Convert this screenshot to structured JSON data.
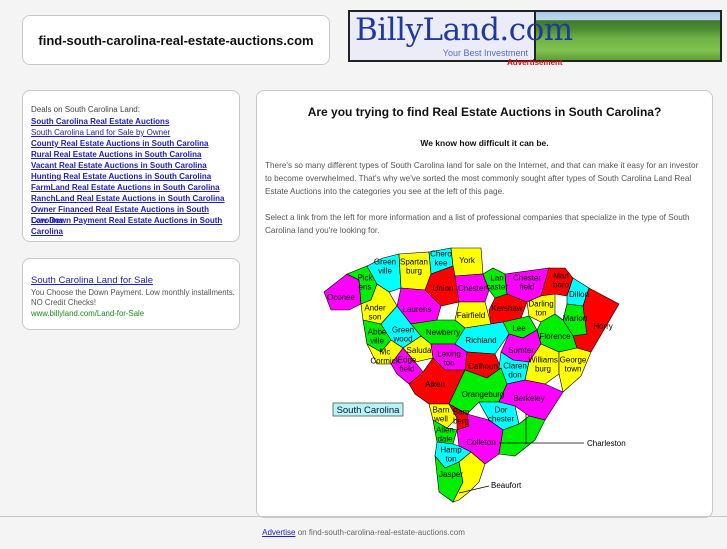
{
  "header": {
    "site_title": "find-south-carolina-real-estate-auctions.com",
    "banner": {
      "brand": "BillyLand.com",
      "tagline": "Your Best Investment",
      "ad_label": "Advertisement"
    }
  },
  "sidebar": {
    "deals_heading": "Deals on South Carolina Land:",
    "links": [
      {
        "label": "South Carolina Real Estate Auctions",
        "bold": true
      },
      {
        "label": "South Carolina Land for Sale by Owner",
        "bold": false
      },
      {
        "label": "County Real Estate Auctions in South Carolina",
        "bold": true
      },
      {
        "label": "Rural Real Estate Auctions in South Carolina",
        "bold": true
      },
      {
        "label": "Vacant Real Estate Auctions in South Carolina",
        "bold": true
      },
      {
        "label": "Hunting Real Estate Auctions in South Carolina",
        "bold": true
      },
      {
        "label": "FarmLand Real Estate Auctions in South Carolina",
        "bold": true
      },
      {
        "label": "RanchLand Real Estate Auctions in South Carolina",
        "bold": true
      },
      {
        "label": "Owner Financed Real Estate Auctions in South Carolina",
        "bold": true
      },
      {
        "label": "Low Down Payment Real Estate Auctions in South Carolina",
        "bold": true
      }
    ],
    "ad": {
      "title": "South Carolina Land for Sale",
      "description": "You Choose the Down Payment. Low monthly installments. NO Credit Checks!",
      "url": "www.billyland.com/Land-for-Sale"
    }
  },
  "main": {
    "headline": "Are you trying to find Real Estate Auctions in South Carolina?",
    "subheadline": "We know how difficult it can be.",
    "paragraph1": "There's so many different types of South Carolina land for sale on the Internet, and that can make it easy for an investor to become overwhelmed. That's why we've sorted the most commonly sought after types of South Carolina Land Real Estate Auctions into the categories you see at the left of this page.",
    "paragraph2": "Select a link from the left for more information and a list of professional companies that specialize in the type of South Carolina land you're looking for.",
    "map": {
      "state_label": "South Carolina",
      "colors": {
        "yellow": "#ffff00",
        "cyan": "#00ffff",
        "magenta": "#ff00ff",
        "green": "#00ee00",
        "red": "#ff0000"
      },
      "counties": [
        {
          "name": "Oconee",
          "lines": [
            "Oconee"
          ],
          "color": "magenta"
        },
        {
          "name": "Pickens",
          "lines": [
            "Pick",
            "ens"
          ],
          "color": "green"
        },
        {
          "name": "Greenville",
          "lines": [
            "Green",
            "ville"
          ],
          "color": "cyan"
        },
        {
          "name": "Spartanburg",
          "lines": [
            "Spartan",
            "burg"
          ],
          "color": "yellow"
        },
        {
          "name": "Cherokee",
          "lines": [
            "Chero",
            "kee"
          ],
          "color": "cyan"
        },
        {
          "name": "York",
          "lines": [
            "York"
          ],
          "color": "yellow"
        },
        {
          "name": "Union",
          "lines": [
            "Union"
          ],
          "color": "red"
        },
        {
          "name": "Chester",
          "lines": [
            "Chester"
          ],
          "color": "magenta"
        },
        {
          "name": "Lancaster",
          "lines": [
            "Lan",
            "caster"
          ],
          "color": "green"
        },
        {
          "name": "Chesterfield",
          "lines": [
            "Chester",
            "field"
          ],
          "color": "magenta"
        },
        {
          "name": "Marlboro",
          "lines": [
            "Marl",
            "boro"
          ],
          "color": "red"
        },
        {
          "name": "Dillon",
          "lines": [
            "Dillon"
          ],
          "color": "cyan"
        },
        {
          "name": "Anderson",
          "lines": [
            "Ander",
            "son"
          ],
          "color": "yellow"
        },
        {
          "name": "Laurens",
          "lines": [
            "Laurens"
          ],
          "color": "magenta"
        },
        {
          "name": "Fairfield",
          "lines": [
            "Fairfield"
          ],
          "color": "yellow"
        },
        {
          "name": "Kershaw",
          "lines": [
            "Kershaw"
          ],
          "color": "red"
        },
        {
          "name": "Darlington",
          "lines": [
            "Darling",
            "ton"
          ],
          "color": "yellow"
        },
        {
          "name": "Marion",
          "lines": [
            "Marion"
          ],
          "color": "green"
        },
        {
          "name": "Horry",
          "lines": [
            "Horry"
          ],
          "color": "red"
        },
        {
          "name": "Newberry",
          "lines": [
            "Newberry"
          ],
          "color": "green"
        },
        {
          "name": "Lee",
          "lines": [
            "Lee"
          ],
          "color": "green"
        },
        {
          "name": "Florence",
          "lines": [
            "Florence"
          ],
          "color": "green"
        },
        {
          "name": "Abbeville",
          "lines": [
            "Abbe",
            "ville"
          ],
          "color": "green"
        },
        {
          "name": "Greenwood",
          "lines": [
            "Green",
            "wood"
          ],
          "color": "cyan"
        },
        {
          "name": "Saluda",
          "lines": [
            "Saluda"
          ],
          "color": "yellow"
        },
        {
          "name": "Richland",
          "lines": [
            "Richland"
          ],
          "color": "cyan"
        },
        {
          "name": "Sumter",
          "lines": [
            "Sumter"
          ],
          "color": "magenta"
        },
        {
          "name": "McCormick",
          "lines": [
            "Mc",
            "Cormick"
          ],
          "color": "yellow"
        },
        {
          "name": "Edgefield",
          "lines": [
            "Edge",
            "field"
          ],
          "color": "magenta"
        },
        {
          "name": "Lexington",
          "lines": [
            "Lexing",
            "ton"
          ],
          "color": "magenta"
        },
        {
          "name": "Calhoun",
          "lines": [
            "Calhoun"
          ],
          "color": "red"
        },
        {
          "name": "Clarendon",
          "lines": [
            "Claren",
            "don"
          ],
          "color": "cyan"
        },
        {
          "name": "Williamsburg",
          "lines": [
            "Williams",
            "burg"
          ],
          "color": "yellow"
        },
        {
          "name": "Georgetown",
          "lines": [
            "George",
            "town"
          ],
          "color": "yellow"
        },
        {
          "name": "Aiken",
          "lines": [
            "Aiken"
          ],
          "color": "red"
        },
        {
          "name": "Orangeburg",
          "lines": [
            "Orangeburg"
          ],
          "color": "green"
        },
        {
          "name": "Berkeley",
          "lines": [
            "Berkeley"
          ],
          "color": "magenta"
        },
        {
          "name": "Barnwell",
          "lines": [
            "Barn",
            "well"
          ],
          "color": "yellow"
        },
        {
          "name": "Bamberg",
          "lines": [
            "Bam",
            "berg"
          ],
          "color": "red"
        },
        {
          "name": "Dorchester",
          "lines": [
            "Dor",
            "chester"
          ],
          "color": "cyan"
        },
        {
          "name": "Allendale",
          "lines": [
            "Allen",
            "dale"
          ],
          "color": "green"
        },
        {
          "name": "Colleton",
          "lines": [
            "Colleton"
          ],
          "color": "magenta"
        },
        {
          "name": "Charleston",
          "lines": [
            "Charleston"
          ],
          "color": "green"
        },
        {
          "name": "Hampton",
          "lines": [
            "Hamp",
            "ton"
          ],
          "color": "cyan"
        },
        {
          "name": "Jasper",
          "lines": [
            "Jasper"
          ],
          "color": "green"
        },
        {
          "name": "Beaufort",
          "lines": [
            "Beaufort"
          ],
          "color": "yellow"
        }
      ]
    }
  },
  "footer": {
    "advertise_label": "Advertise",
    "suffix": " on find-south-carolina-real-estate-auctions.com"
  }
}
